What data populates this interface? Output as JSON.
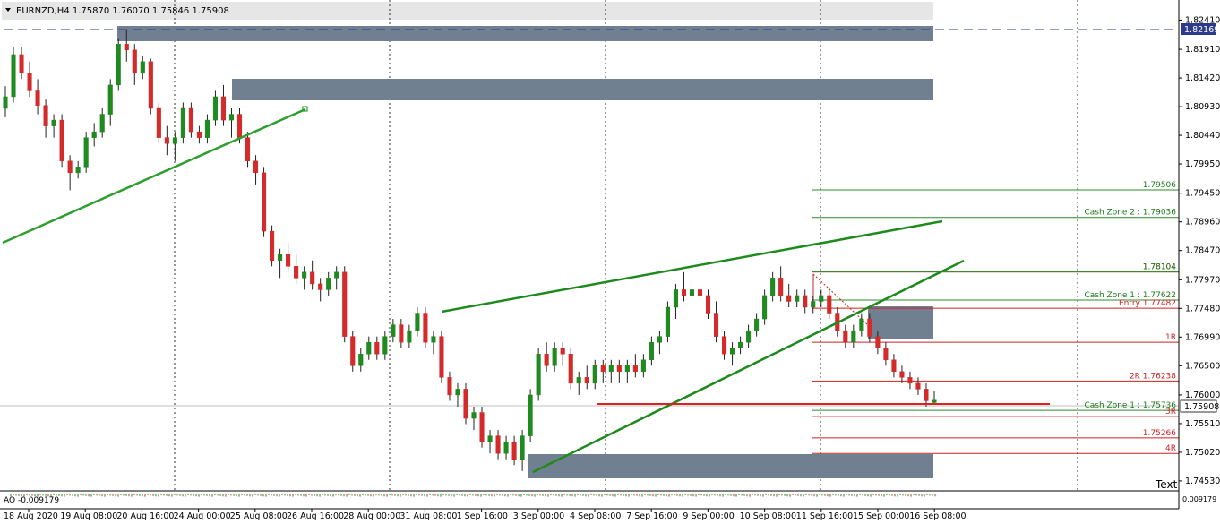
{
  "window": {
    "symbol_header": "EURNZD,H4  1.75870 1.76070 1.75846 1.75908",
    "menu_icon": "triangle-down-icon",
    "corner_text": "Text"
  },
  "indicator": {
    "label": "AO -0.009179",
    "right_values": "0.009179"
  },
  "price_markers": {
    "dashed_line_value": "1.82169",
    "current_price": "1.75908"
  },
  "levels": [
    {
      "label": "1.79506",
      "price": 1.79506,
      "color": "green"
    },
    {
      "label": "Cash Zone 2 : 1.79036",
      "price": 1.79036,
      "color": "green"
    },
    {
      "label": "1.78104",
      "price": 1.78104,
      "color": "red"
    },
    {
      "label": "1.78104",
      "price": 1.78104,
      "color": "green"
    },
    {
      "label": "Cash Zone 1 : 1.77622",
      "price": 1.77622,
      "color": "green"
    },
    {
      "label": "Entry 1.77482",
      "price": 1.77482,
      "color": "red"
    },
    {
      "label": "1R",
      "price": 1.769,
      "color": "red"
    },
    {
      "label": "2R 1.76238",
      "price": 1.76238,
      "color": "red"
    },
    {
      "label": "Cash Zone 1 : 1.75736",
      "price": 1.75736,
      "color": "green"
    },
    {
      "label": "3R",
      "price": 1.7563,
      "color": "red"
    },
    {
      "label": "1.75266",
      "price": 1.75266,
      "color": "red"
    },
    {
      "label": "4R",
      "price": 1.75,
      "color": "red"
    }
  ],
  "chart_data": {
    "type": "candlestick",
    "title": "EURNZD,H4",
    "ylim": [
      1.7436,
      1.8257
    ],
    "y_ticks": [
      "1.82410",
      "1.81910",
      "1.81420",
      "1.80930",
      "1.80440",
      "1.79950",
      "1.79450",
      "1.78960",
      "1.78470",
      "1.77970",
      "1.77480",
      "1.76990",
      "1.76500",
      "1.76000",
      "1.75510",
      "1.75020",
      "1.74530"
    ],
    "x_ticks": [
      "18 Aug 2020",
      "19 Aug 08:00",
      "20 Aug 16:00",
      "24 Aug 00:00",
      "25 Aug 08:00",
      "26 Aug 16:00",
      "28 Aug 00:00",
      "31 Aug 08:00",
      "1 Sep 16:00",
      "3 Sep 00:00",
      "4 Sep 08:00",
      "7 Sep 16:00",
      "9 Sep 00:00",
      "10 Sep 08:00",
      "11 Sep 16:00",
      "15 Sep 00:00",
      "16 Sep 08:00"
    ],
    "grid": "vertical dotted separators",
    "candles": [
      [
        1.809,
        1.8128,
        1.8075,
        1.811
      ],
      [
        1.811,
        1.8195,
        1.81,
        1.8182
      ],
      [
        1.8182,
        1.8195,
        1.814,
        1.815
      ],
      [
        1.815,
        1.817,
        1.811,
        1.812
      ],
      [
        1.812,
        1.814,
        1.808,
        1.8095
      ],
      [
        1.8095,
        1.8105,
        1.804,
        1.806
      ],
      [
        1.806,
        1.808,
        1.804,
        1.807
      ],
      [
        1.807,
        1.808,
        1.799,
        1.8
      ],
      [
        1.8,
        1.801,
        1.795,
        1.798
      ],
      [
        1.798,
        1.8,
        1.797,
        1.799
      ],
      [
        1.799,
        1.805,
        1.798,
        1.804
      ],
      [
        1.804,
        1.8065,
        1.8025,
        1.805
      ],
      [
        1.805,
        1.809,
        1.804,
        1.808
      ],
      [
        1.808,
        1.814,
        1.806,
        1.813
      ],
      [
        1.813,
        1.821,
        1.812,
        1.82
      ],
      [
        1.82,
        1.8225,
        1.817,
        1.819
      ],
      [
        1.819,
        1.82,
        1.813,
        1.815
      ],
      [
        1.815,
        1.818,
        1.814,
        1.817
      ],
      [
        1.817,
        1.8175,
        1.808,
        1.809
      ],
      [
        1.809,
        1.81,
        1.803,
        1.804
      ],
      [
        1.804,
        1.806,
        1.801,
        1.803
      ],
      [
        1.803,
        1.805,
        1.8,
        1.804
      ],
      [
        1.804,
        1.81,
        1.803,
        1.809
      ],
      [
        1.809,
        1.81,
        1.804,
        1.805
      ],
      [
        1.805,
        1.806,
        1.803,
        1.804
      ],
      [
        1.804,
        1.808,
        1.803,
        1.807
      ],
      [
        1.807,
        1.812,
        1.806,
        1.811
      ],
      [
        1.811,
        1.813,
        1.806,
        1.807
      ],
      [
        1.807,
        1.809,
        1.804,
        1.808
      ],
      [
        1.808,
        1.809,
        1.803,
        1.804
      ],
      [
        1.804,
        1.805,
        1.799,
        1.8
      ],
      [
        1.8,
        1.801,
        1.796,
        1.798
      ],
      [
        1.798,
        1.799,
        1.787,
        1.788
      ],
      [
        1.788,
        1.789,
        1.782,
        1.783
      ],
      [
        1.783,
        1.785,
        1.78,
        1.784
      ],
      [
        1.784,
        1.786,
        1.781,
        1.782
      ],
      [
        1.782,
        1.784,
        1.779,
        1.78
      ],
      [
        1.78,
        1.782,
        1.778,
        1.781
      ],
      [
        1.781,
        1.783,
        1.778,
        1.779
      ],
      [
        1.779,
        1.78,
        1.776,
        1.778
      ],
      [
        1.778,
        1.781,
        1.777,
        1.78
      ],
      [
        1.78,
        1.782,
        1.778,
        1.781
      ],
      [
        1.781,
        1.782,
        1.769,
        1.77
      ],
      [
        1.77,
        1.771,
        1.764,
        1.765
      ],
      [
        1.765,
        1.768,
        1.764,
        1.767
      ],
      [
        1.767,
        1.77,
        1.766,
        1.769
      ],
      [
        1.769,
        1.77,
        1.766,
        1.767
      ],
      [
        1.767,
        1.771,
        1.766,
        1.77
      ],
      [
        1.77,
        1.773,
        1.769,
        1.772
      ],
      [
        1.772,
        1.773,
        1.768,
        1.769
      ],
      [
        1.769,
        1.772,
        1.768,
        1.771
      ],
      [
        1.771,
        1.775,
        1.77,
        1.774
      ],
      [
        1.774,
        1.775,
        1.768,
        1.769
      ],
      [
        1.769,
        1.771,
        1.767,
        1.77
      ],
      [
        1.77,
        1.771,
        1.762,
        1.763
      ],
      [
        1.763,
        1.764,
        1.759,
        1.76
      ],
      [
        1.76,
        1.762,
        1.758,
        1.761
      ],
      [
        1.761,
        1.762,
        1.755,
        1.756
      ],
      [
        1.756,
        1.758,
        1.754,
        1.757
      ],
      [
        1.757,
        1.758,
        1.751,
        1.752
      ],
      [
        1.752,
        1.754,
        1.75,
        1.753
      ],
      [
        1.753,
        1.754,
        1.749,
        1.75
      ],
      [
        1.75,
        1.753,
        1.749,
        1.752
      ],
      [
        1.752,
        1.753,
        1.748,
        1.749
      ],
      [
        1.749,
        1.754,
        1.747,
        1.753
      ],
      [
        1.753,
        1.761,
        1.752,
        1.76
      ],
      [
        1.76,
        1.768,
        1.759,
        1.767
      ],
      [
        1.767,
        1.769,
        1.764,
        1.765
      ],
      [
        1.765,
        1.769,
        1.764,
        1.768
      ],
      [
        1.768,
        1.769,
        1.765,
        1.767
      ],
      [
        1.767,
        1.768,
        1.761,
        1.762
      ],
      [
        1.762,
        1.764,
        1.76,
        1.763
      ],
      [
        1.763,
        1.765,
        1.761,
        1.762
      ],
      [
        1.762,
        1.766,
        1.761,
        1.765
      ],
      [
        1.765,
        1.766,
        1.762,
        1.764
      ],
      [
        1.764,
        1.766,
        1.762,
        1.765
      ],
      [
        1.765,
        1.766,
        1.762,
        1.764
      ],
      [
        1.764,
        1.766,
        1.762,
        1.765
      ],
      [
        1.765,
        1.767,
        1.763,
        1.764
      ],
      [
        1.764,
        1.767,
        1.763,
        1.766
      ],
      [
        1.766,
        1.77,
        1.765,
        1.769
      ],
      [
        1.769,
        1.771,
        1.767,
        1.77
      ],
      [
        1.77,
        1.776,
        1.769,
        1.775
      ],
      [
        1.775,
        1.779,
        1.773,
        1.778
      ],
      [
        1.778,
        1.781,
        1.776,
        1.777
      ],
      [
        1.777,
        1.78,
        1.776,
        1.778
      ],
      [
        1.778,
        1.78,
        1.776,
        1.777
      ],
      [
        1.777,
        1.778,
        1.773,
        1.774
      ],
      [
        1.774,
        1.776,
        1.769,
        1.77
      ],
      [
        1.77,
        1.771,
        1.766,
        1.767
      ],
      [
        1.767,
        1.769,
        1.765,
        1.768
      ],
      [
        1.768,
        1.77,
        1.767,
        1.769
      ],
      [
        1.769,
        1.772,
        1.768,
        1.771
      ],
      [
        1.771,
        1.774,
        1.77,
        1.773
      ],
      [
        1.773,
        1.778,
        1.772,
        1.777
      ],
      [
        1.777,
        1.781,
        1.776,
        1.78
      ],
      [
        1.78,
        1.782,
        1.776,
        1.777
      ],
      [
        1.777,
        1.779,
        1.775,
        1.776
      ],
      [
        1.776,
        1.778,
        1.775,
        1.777
      ],
      [
        1.777,
        1.778,
        1.774,
        1.775
      ],
      [
        1.775,
        1.777,
        1.774,
        1.776
      ],
      [
        1.776,
        1.778,
        1.775,
        1.777
      ],
      [
        1.777,
        1.778,
        1.773,
        1.774
      ],
      [
        1.774,
        1.775,
        1.77,
        1.771
      ],
      [
        1.771,
        1.772,
        1.768,
        1.769
      ],
      [
        1.769,
        1.772,
        1.768,
        1.771
      ],
      [
        1.771,
        1.774,
        1.77,
        1.773
      ],
      [
        1.773,
        1.774,
        1.769,
        1.77
      ],
      [
        1.77,
        1.771,
        1.767,
        1.768
      ],
      [
        1.768,
        1.769,
        1.765,
        1.766
      ],
      [
        1.766,
        1.767,
        1.763,
        1.764
      ],
      [
        1.764,
        1.765,
        1.762,
        1.763
      ],
      [
        1.763,
        1.764,
        1.761,
        1.762
      ],
      [
        1.762,
        1.763,
        1.76,
        1.761
      ],
      [
        1.761,
        1.762,
        1.758,
        1.759
      ],
      [
        1.7587,
        1.7607,
        1.7585,
        1.7591
      ]
    ]
  }
}
